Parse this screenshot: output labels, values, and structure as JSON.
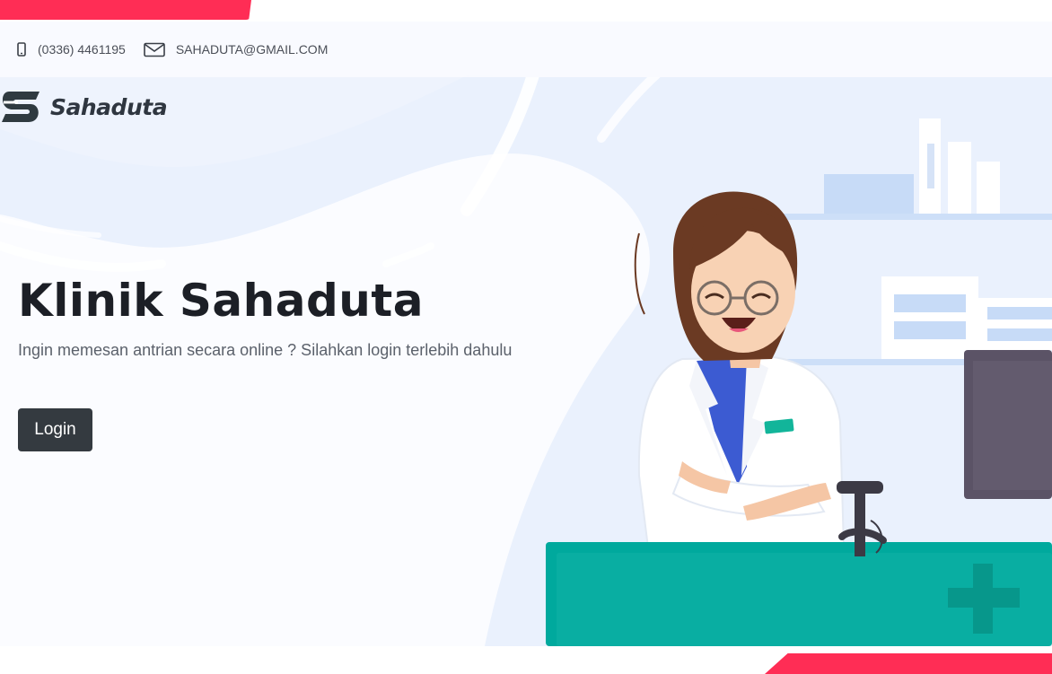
{
  "topbar": {
    "phone": "(0336) 4461195",
    "phone_icon": "phone-icon",
    "email": "SAHADUTA@GMAIL.COM",
    "email_icon": "envelope-icon"
  },
  "brand": {
    "name": "Sahaduta",
    "logo_icon": "sahaduta-logo-icon"
  },
  "hero": {
    "title": "Klinik Sahaduta",
    "subtitle": "Ingin memesan antrian secara online ? Silahkan login terlebih dahulu",
    "login_label": "Login"
  },
  "colors": {
    "accent": "#ff2d55",
    "button": "#343a40",
    "counter": "#00a99d",
    "background": "#eaf1fd"
  }
}
